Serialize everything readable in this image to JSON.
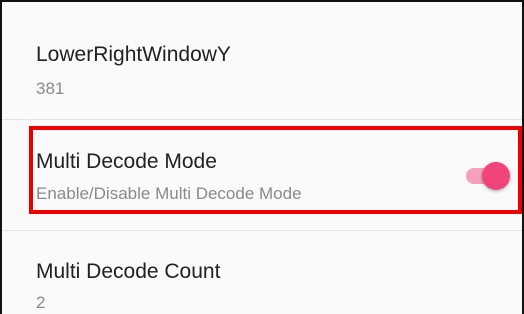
{
  "settings": {
    "items": [
      {
        "title": "LowerRightWindowY",
        "summary": "381"
      },
      {
        "title": "Multi Decode Mode",
        "summary": "Enable/Disable Multi Decode Mode",
        "toggle_on": true
      },
      {
        "title": "Multi Decode Count",
        "summary": "2"
      }
    ]
  },
  "colors": {
    "accent": "#f0447b",
    "accent_track": "#f7a0bd",
    "highlight": "#ee0000",
    "divider": "#e3e3e3",
    "title_text": "#212121",
    "summary_text": "#8a8a8a"
  }
}
